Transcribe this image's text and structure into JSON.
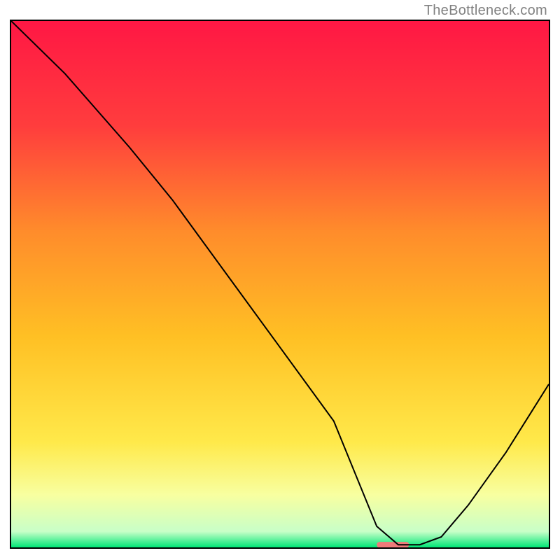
{
  "watermark": "TheBottleneck.com",
  "chart_data": {
    "type": "line",
    "title": "",
    "xlabel": "",
    "ylabel": "",
    "xlim": [
      0,
      100
    ],
    "ylim": [
      0,
      100
    ],
    "background_gradient": {
      "stops": [
        {
          "offset": 0,
          "color": "#ff1744"
        },
        {
          "offset": 20,
          "color": "#ff3d3d"
        },
        {
          "offset": 40,
          "color": "#ff8c2b"
        },
        {
          "offset": 60,
          "color": "#ffc024"
        },
        {
          "offset": 80,
          "color": "#ffe94a"
        },
        {
          "offset": 90,
          "color": "#f8ffa0"
        },
        {
          "offset": 97,
          "color": "#c8ffc8"
        },
        {
          "offset": 100,
          "color": "#00e676"
        }
      ]
    },
    "series": [
      {
        "name": "curve",
        "color": "#000000",
        "x": [
          0,
          10,
          22,
          30,
          40,
          50,
          60,
          64,
          68,
          72,
          76,
          80,
          85,
          92,
          100
        ],
        "y": [
          100,
          90,
          76,
          66,
          52,
          38,
          24,
          14,
          4,
          0.5,
          0.5,
          2,
          8,
          18,
          31
        ]
      }
    ],
    "marker": {
      "name": "optimal-marker",
      "color": "#ef7a7a",
      "x_center": 71,
      "y": 0.5,
      "width": 6,
      "height": 1.1
    }
  }
}
